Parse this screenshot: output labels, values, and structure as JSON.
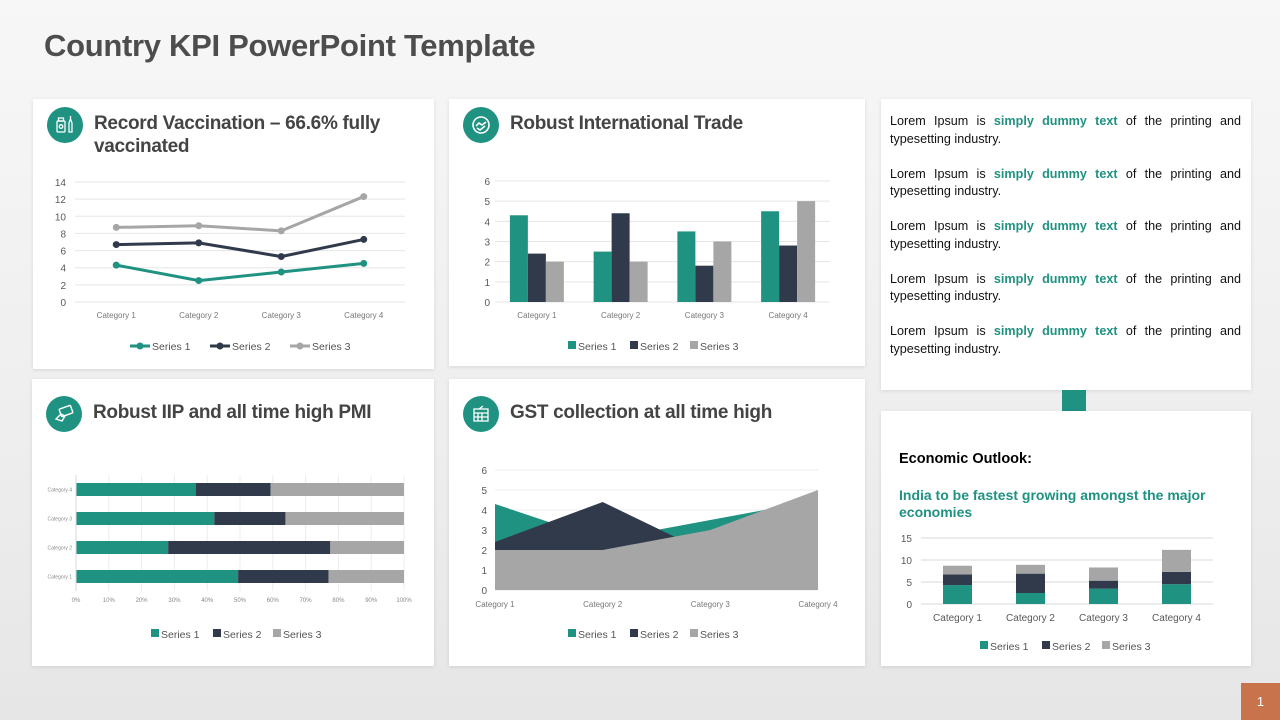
{
  "slide": {
    "title": "Country KPI PowerPoint Template",
    "page_number": "1"
  },
  "colors": {
    "teal": "#1f9282",
    "navy": "#313a4b",
    "gray": "#a6a6a6",
    "accent_orange": "#c8734c"
  },
  "cards": {
    "vaccination": {
      "title_line1": "Record Vaccination – 66.6%  fully",
      "title_line2": "vaccinated",
      "icon": "vaccine-icon"
    },
    "trade": {
      "title": "Robust International Trade",
      "icon": "handshake-icon"
    },
    "iip": {
      "title": "Robust IIP and all time high PMI",
      "icon": "card-hand-icon"
    },
    "gst": {
      "title": "GST collection at all time high",
      "icon": "calculator-icon"
    }
  },
  "text_panel": {
    "paragraphs": [
      {
        "pre": "Lorem Ipsum is ",
        "highlight": "simply dummy text",
        "post": " of the printing and typesetting industry."
      },
      {
        "pre": "Lorem Ipsum is ",
        "highlight": "simply dummy text",
        "post": " of the printing and typesetting industry."
      },
      {
        "pre": "Lorem Ipsum is ",
        "highlight": "simply dummy text",
        "post": " of the printing and typesetting industry."
      },
      {
        "pre": "Lorem Ipsum is ",
        "highlight": "simply dummy text",
        "post": " of the printing and typesetting industry."
      },
      {
        "pre": "Lorem Ipsum is ",
        "highlight": "simply dummy text",
        "post": " of the printing and typesetting industry."
      }
    ]
  },
  "outlook": {
    "label": "Economic Outlook:",
    "subtitle": "India to be fastest growing amongst the major economies"
  },
  "chart_data": [
    {
      "id": "vaccination",
      "type": "line",
      "stacked": true,
      "title": "Record Vaccination – 66.6% fully vaccinated",
      "categories": [
        "Category 1",
        "Category 2",
        "Category 3",
        "Category 4"
      ],
      "series": [
        {
          "name": "Series 1",
          "values": [
            4.3,
            2.5,
            3.5,
            4.5
          ]
        },
        {
          "name": "Series 2",
          "values": [
            2.4,
            4.4,
            1.8,
            2.8
          ]
        },
        {
          "name": "Series 3",
          "values": [
            2,
            2,
            3,
            5
          ]
        }
      ],
      "yticks": [
        "0",
        "2",
        "4",
        "6",
        "8",
        "10",
        "12",
        "14"
      ],
      "ylim": [
        0,
        14
      ],
      "grid": true,
      "legend": "bottom",
      "legend_labels": [
        "Series 1",
        "Series 2",
        "Series 3"
      ]
    },
    {
      "id": "trade",
      "type": "bar",
      "title": "Robust International Trade",
      "categories": [
        "Category 1",
        "Category 2",
        "Category 3",
        "Category 4"
      ],
      "series": [
        {
          "name": "Series 1",
          "values": [
            4.3,
            2.5,
            3.5,
            4.5
          ]
        },
        {
          "name": "Series 2",
          "values": [
            2.4,
            4.4,
            1.8,
            2.8
          ]
        },
        {
          "name": "Series 3",
          "values": [
            2,
            2,
            3,
            5
          ]
        }
      ],
      "yticks": [
        "0",
        "1",
        "2",
        "3",
        "4",
        "5",
        "6"
      ],
      "ylim": [
        0,
        6
      ],
      "grid": true,
      "legend": "bottom",
      "legend_labels": [
        "Series 1",
        "Series 2",
        "Series 3"
      ]
    },
    {
      "id": "iip",
      "type": "bar",
      "orientation": "horizontal",
      "stacked_percent": true,
      "title": "Robust IIP and all time high PMI",
      "categories": [
        "Category 1",
        "Category 2",
        "Category 3",
        "Category 4"
      ],
      "series": [
        {
          "name": "Series 1",
          "values": [
            4.3,
            2.5,
            3.5,
            4.5
          ]
        },
        {
          "name": "Series 2",
          "values": [
            2.4,
            4.4,
            1.8,
            2.8
          ]
        },
        {
          "name": "Series 3",
          "values": [
            2,
            2,
            3,
            5
          ]
        }
      ],
      "xticks": [
        "0%",
        "10%",
        "20%",
        "30%",
        "40%",
        "50%",
        "60%",
        "70%",
        "80%",
        "90%",
        "100%"
      ],
      "xlim": [
        0,
        100
      ],
      "grid": true,
      "legend": "bottom",
      "legend_labels": [
        "Series 1",
        "Series 2",
        "Series 3"
      ]
    },
    {
      "id": "gst",
      "type": "area",
      "title": "GST collection at all time high",
      "categories": [
        "Category 1",
        "Category 2",
        "Category 3",
        "Category 4"
      ],
      "series": [
        {
          "name": "Series 1",
          "values": [
            4.3,
            2.5,
            3.5,
            4.5
          ]
        },
        {
          "name": "Series 2",
          "values": [
            2.4,
            4.4,
            1.8,
            2.8
          ]
        },
        {
          "name": "Series 3",
          "values": [
            2,
            2,
            3,
            5
          ]
        }
      ],
      "yticks": [
        "0",
        "1",
        "2",
        "3",
        "4",
        "5",
        "6"
      ],
      "ylim": [
        0,
        6
      ],
      "grid": true,
      "legend": "bottom",
      "legend_labels": [
        "Series 1",
        "Series 2",
        "Series 3"
      ]
    },
    {
      "id": "outlook",
      "type": "bar",
      "stacked": true,
      "title": "India to be fastest growing amongst the major economies",
      "categories": [
        "Category 1",
        "Category 2",
        "Category 3",
        "Category 4"
      ],
      "series": [
        {
          "name": "Series 1",
          "values": [
            4.3,
            2.5,
            3.5,
            4.5
          ]
        },
        {
          "name": "Series 2",
          "values": [
            2.4,
            4.4,
            1.8,
            2.8
          ]
        },
        {
          "name": "Series 3",
          "values": [
            2,
            2,
            3,
            5
          ]
        }
      ],
      "yticks": [
        "0",
        "5",
        "10",
        "15"
      ],
      "ylim": [
        0,
        15
      ],
      "grid": true,
      "legend": "bottom",
      "legend_labels": [
        "Series 1",
        "Series 2",
        "Series 3"
      ]
    }
  ]
}
